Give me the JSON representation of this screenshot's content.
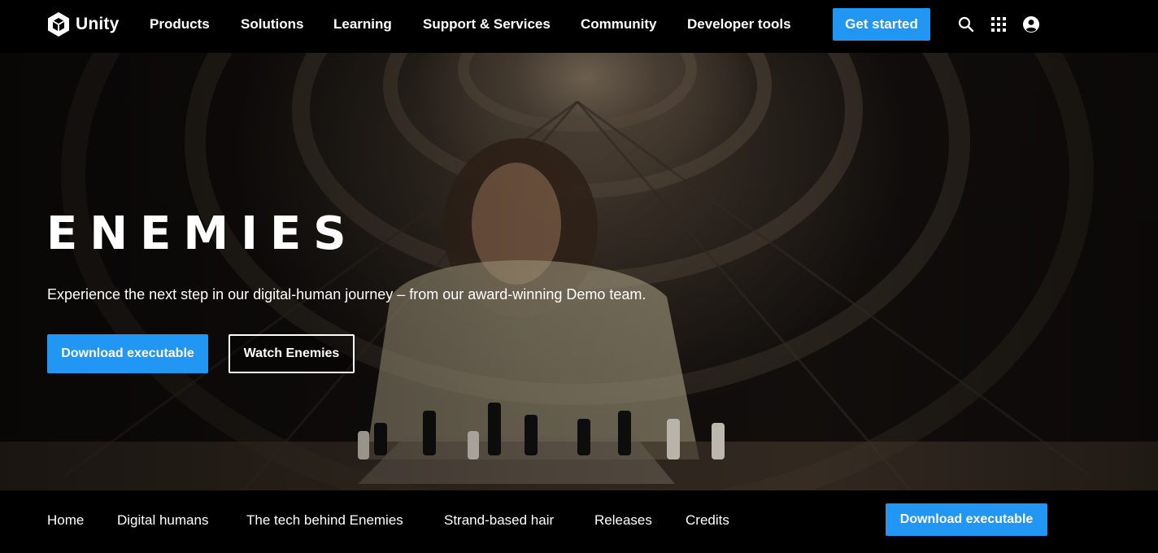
{
  "header": {
    "logo_text": "Unity",
    "nav": [
      "Products",
      "Solutions",
      "Learning",
      "Support & Services",
      "Community",
      "Developer tools"
    ],
    "cta_label": "Get started",
    "icons": [
      "search-icon",
      "apps-grid-icon",
      "account-icon"
    ]
  },
  "hero": {
    "title": "ENEMIES",
    "subtitle": "Experience the next step in our digital-human journey – from our award-winning Demo team.",
    "primary_button": "Download executable",
    "secondary_button": "Watch Enemies"
  },
  "subnav": {
    "items": [
      "Home",
      "Digital humans",
      "The tech behind Enemies",
      "Strand-based hair",
      "Releases",
      "Credits"
    ],
    "cta_label": "Download executable"
  },
  "colors": {
    "accent": "#2196f3",
    "background": "#000000"
  }
}
